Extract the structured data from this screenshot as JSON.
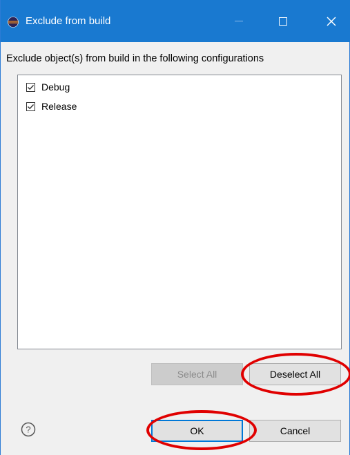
{
  "window": {
    "title": "Exclude from build",
    "icon": "eclipse-icon",
    "controls": [
      "minimize-icon",
      "maximize-icon",
      "close-icon"
    ],
    "close_glyph": "✕"
  },
  "prompt": "Exclude object(s) from build in the following configurations",
  "configurations": [
    {
      "label": "Debug",
      "checked": true
    },
    {
      "label": "Release",
      "checked": true
    }
  ],
  "buttons": {
    "select_all": {
      "label": "Select All",
      "enabled": false
    },
    "deselect_all": {
      "label": "Deselect All",
      "enabled": true
    },
    "ok": {
      "label": "OK",
      "default": true
    },
    "cancel": {
      "label": "Cancel"
    }
  },
  "help": {
    "glyph": "?"
  },
  "annotations": {
    "color": "#e00000",
    "circled": [
      "deselect-all-button",
      "ok-button"
    ]
  },
  "colors": {
    "titlebar": "#1979d0",
    "dialog_bg": "#f0f0f0",
    "focus": "#0078d7"
  }
}
